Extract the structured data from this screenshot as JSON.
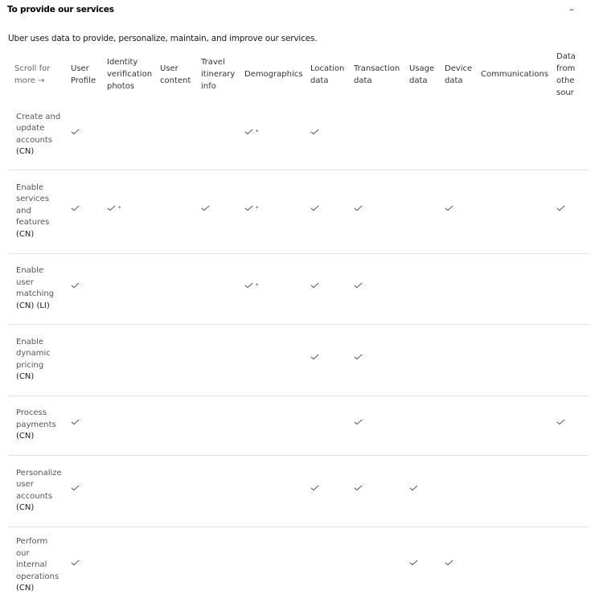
{
  "section": {
    "title": "To provide our services",
    "collapse_icon": "minus-icon",
    "collapse_label": "–",
    "intro": "Uber uses data to provide, personalize, maintain, and improve our services."
  },
  "table": {
    "scroll_hint": [
      "Scroll for",
      "more →"
    ],
    "columns": [
      {
        "key": "user_profile",
        "lines": [
          "User",
          "Profile"
        ]
      },
      {
        "key": "identity_photos",
        "lines": [
          "Identity",
          "verification",
          "photos"
        ]
      },
      {
        "key": "user_content",
        "lines": [
          "User",
          "content"
        ]
      },
      {
        "key": "travel_itinerary",
        "lines": [
          "Travel",
          "itinerary",
          "info"
        ]
      },
      {
        "key": "demographics",
        "lines": [
          "Demographics"
        ]
      },
      {
        "key": "location",
        "lines": [
          "Location",
          "data"
        ]
      },
      {
        "key": "transaction",
        "lines": [
          "Transaction",
          "data"
        ]
      },
      {
        "key": "usage",
        "lines": [
          "Usage",
          "data"
        ]
      },
      {
        "key": "device",
        "lines": [
          "Device",
          "data"
        ]
      },
      {
        "key": "communications",
        "lines": [
          "Communications"
        ]
      },
      {
        "key": "other_sources",
        "lines": [
          "Data",
          "from",
          "othe",
          "sour"
        ]
      }
    ],
    "check_icon": "checkmark-icon",
    "legend": {
      "check": "✓",
      "check_star": "✓*"
    },
    "rows": [
      {
        "purpose": [
          "Create and",
          "update",
          "accounts"
        ],
        "tags": "(CN)",
        "cells": [
          "check",
          "",
          "",
          "",
          "check*",
          "check",
          "",
          "",
          "",
          "",
          ""
        ]
      },
      {
        "purpose": [
          "Enable",
          "services",
          "and",
          "features"
        ],
        "tags": "(CN)",
        "cells": [
          "check",
          "check*",
          "",
          "check",
          "check*",
          "check",
          "check",
          "",
          "check",
          "",
          "check"
        ]
      },
      {
        "purpose": [
          "Enable",
          "user",
          "matching"
        ],
        "tags": "(CN) (LI)",
        "cells": [
          "check",
          "",
          "",
          "",
          "check*",
          "check",
          "check",
          "",
          "",
          "",
          ""
        ]
      },
      {
        "purpose": [
          "Enable",
          "dynamic",
          "pricing"
        ],
        "tags": "(CN)",
        "cells": [
          "",
          "",
          "",
          "",
          "",
          "check",
          "check",
          "",
          "",
          "",
          ""
        ]
      },
      {
        "purpose": [
          "Process",
          "payments"
        ],
        "tags": "(CN)",
        "cells": [
          "check",
          "",
          "",
          "",
          "",
          "",
          "check",
          "",
          "",
          "",
          "check"
        ]
      },
      {
        "purpose": [
          "Personalize",
          "user",
          "accounts"
        ],
        "tags": "(CN)",
        "cells": [
          "check",
          "",
          "",
          "",
          "",
          "check",
          "check",
          "check",
          "",
          "",
          ""
        ]
      },
      {
        "purpose": [
          "Perform",
          "our",
          "internal",
          "operations"
        ],
        "tags": "(CN)",
        "cells": [
          "check",
          "",
          "",
          "",
          "",
          "",
          "",
          "check",
          "check",
          "",
          ""
        ]
      }
    ]
  }
}
